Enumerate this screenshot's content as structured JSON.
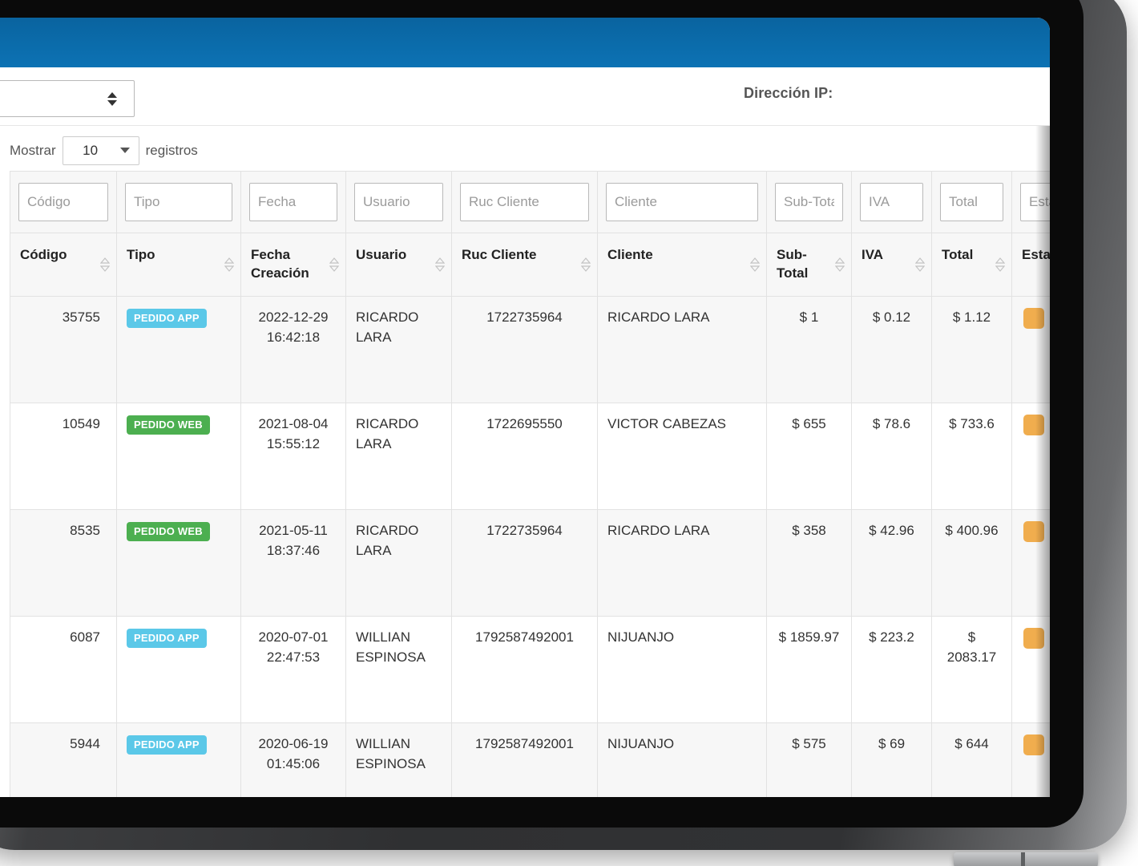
{
  "device": {
    "kind": "tablet-frame"
  },
  "topbar": {
    "color": "#0b6cab"
  },
  "subbar": {
    "ip_label": "Dirección IP:",
    "selector_value": ""
  },
  "datatable": {
    "length_label_before": "Mostrar",
    "length_value": "10",
    "length_label_after": "registros",
    "columns": [
      {
        "key": "codigo",
        "label": "Código",
        "filter_placeholder": "Código",
        "sortable": true
      },
      {
        "key": "tipo",
        "label": "Tipo",
        "filter_placeholder": "Tipo",
        "sortable": true
      },
      {
        "key": "fecha",
        "label": "Fecha Creación",
        "filter_placeholder": "Fecha",
        "sortable": true
      },
      {
        "key": "usuario",
        "label": "Usuario",
        "filter_placeholder": "Usuario",
        "sortable": true
      },
      {
        "key": "ruc",
        "label": "Ruc Cliente",
        "filter_placeholder": "Ruc Cliente",
        "sortable": true
      },
      {
        "key": "cliente",
        "label": "Cliente",
        "filter_placeholder": "Cliente",
        "sortable": true
      },
      {
        "key": "subtotal",
        "label": "Sub-Total",
        "filter_placeholder": "Sub-Total",
        "sortable": true
      },
      {
        "key": "iva",
        "label": "IVA",
        "filter_placeholder": "IVA",
        "sortable": true
      },
      {
        "key": "total",
        "label": "Total",
        "filter_placeholder": "Total",
        "sortable": true
      },
      {
        "key": "estado",
        "label": "Estado",
        "filter_placeholder": "Estado",
        "sortable": true
      }
    ],
    "rows": [
      {
        "codigo": "35755",
        "tipo": "PEDIDO APP",
        "tipo_color": "#5bc8e8",
        "fecha": "2022-12-29 16:42:18",
        "usuario": "RICARDO LARA",
        "ruc": "1722735964",
        "cliente": "RICARDO LARA",
        "subtotal": "$ 1",
        "iva": "$ 0.12",
        "total": "$ 1.12",
        "estado": "",
        "estado_color": "#f0ad4e"
      },
      {
        "codigo": "10549",
        "tipo": "PEDIDO WEB",
        "tipo_color": "#4caf50",
        "fecha": "2021-08-04 15:55:12",
        "usuario": "RICARDO LARA",
        "ruc": "1722695550",
        "cliente": "VICTOR CABEZAS",
        "subtotal": "$ 655",
        "iva": "$ 78.6",
        "total": "$ 733.6",
        "estado": "",
        "estado_color": "#f0ad4e"
      },
      {
        "codigo": "8535",
        "tipo": "PEDIDO WEB",
        "tipo_color": "#4caf50",
        "fecha": "2021-05-11 18:37:46",
        "usuario": "RICARDO LARA",
        "ruc": "1722735964",
        "cliente": "RICARDO LARA",
        "subtotal": "$ 358",
        "iva": "$ 42.96",
        "total": "$ 400.96",
        "estado": "",
        "estado_color": "#f0ad4e"
      },
      {
        "codigo": "6087",
        "tipo": "PEDIDO APP",
        "tipo_color": "#5bc8e8",
        "fecha": "2020-07-01 22:47:53",
        "usuario": "WILLIAN ESPINOSA",
        "ruc": "1792587492001",
        "cliente": "NIJUANJO",
        "subtotal": "$ 1859.97",
        "iva": "$ 223.2",
        "total": "$ 2083.17",
        "estado": "",
        "estado_color": "#f0ad4e"
      },
      {
        "codigo": "5944",
        "tipo": "PEDIDO APP",
        "tipo_color": "#5bc8e8",
        "fecha": "2020-06-19 01:45:06",
        "usuario": "WILLIAN ESPINOSA",
        "ruc": "1792587492001",
        "cliente": "NIJUANJO",
        "subtotal": "$ 575",
        "iva": "$ 69",
        "total": "$ 644",
        "estado": "",
        "estado_color": "#f0ad4e"
      }
    ]
  }
}
